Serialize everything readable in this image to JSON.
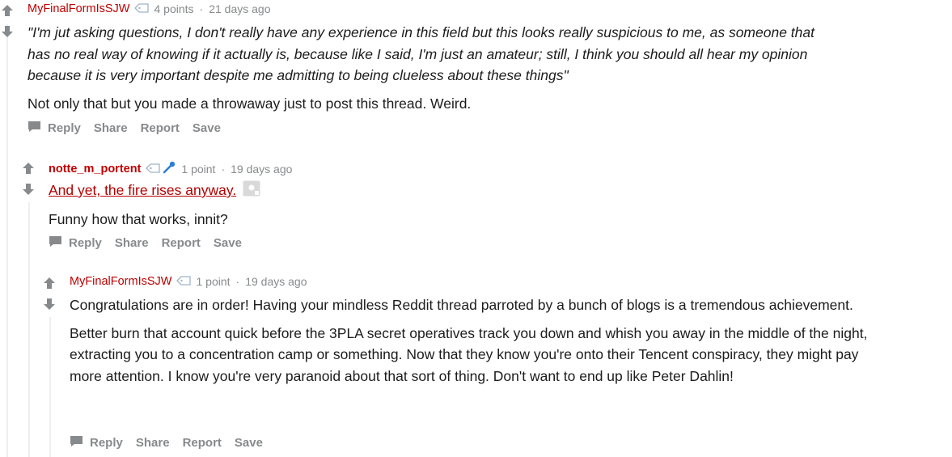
{
  "comments": [
    {
      "author": "MyFinalFormIsSJW",
      "points": "4 points",
      "age": "21 days ago",
      "quote": "\"I'm jut asking questions, I don't really have any experience in this field but this looks really suspicious to me, as someone that has no real way of knowing if it actually is, because like I said, I'm just an amateur; still, I think you should all hear my opinion because it is very important despite me admitting to being clueless about these things\"",
      "text": "Not only that but you made a throwaway just to post this thread. Weird."
    },
    {
      "author": "notte_m_portent",
      "points": "1 point",
      "age": "19 days ago",
      "link_text": "And yet, the fire rises anyway.",
      "text": "Funny how that works, innit?"
    },
    {
      "author": "MyFinalFormIsSJW",
      "points": "1 point",
      "age": "19 days ago",
      "para1": "Congratulations are in order! Having your mindless Reddit thread parroted by a bunch of blogs is a tremendous achievement.",
      "para2": "Better burn that account quick before the 3PLA secret operatives track you down and whish you away in the middle of the night, extracting you to a concentration camp or something. Now that they know you're onto their Tencent conspiracy, they might pay more attention. I know you're very paranoid about that sort of thing. Don't want to end up like Peter Dahlin!"
    }
  ],
  "actions": {
    "reply": "Reply",
    "share": "Share",
    "report": "Report",
    "save": "Save"
  },
  "separator": "·",
  "icons": {
    "upvote": "upvote-arrow-icon",
    "downvote": "downvote-arrow-icon",
    "tag": "tag-icon",
    "pen": "pen-icon",
    "image": "image-icon",
    "reply": "comment-bubble-icon"
  },
  "colors": {
    "author": "#c00000",
    "meta": "#878a8c",
    "arrow": "#878a8c",
    "thread_line": "#edeff1"
  }
}
